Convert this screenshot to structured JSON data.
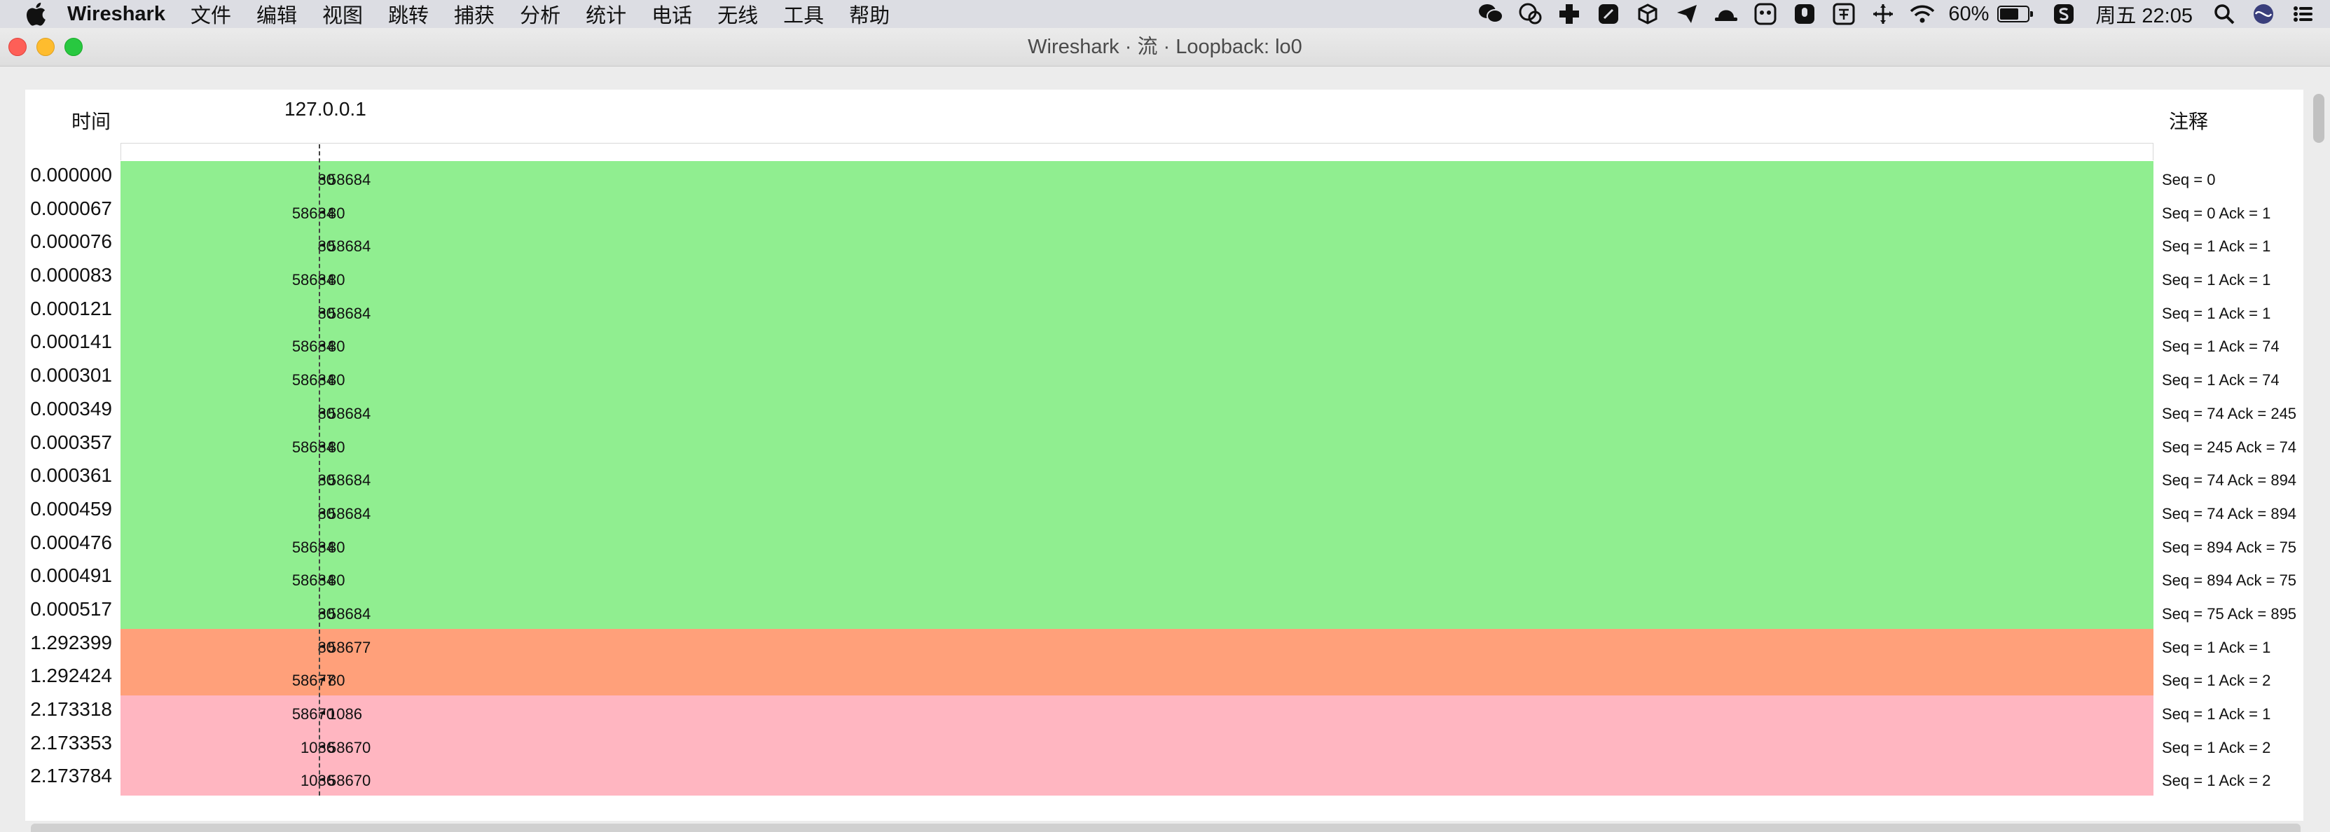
{
  "menubar": {
    "app": "Wireshark",
    "items": [
      "文件",
      "编辑",
      "视图",
      "跳转",
      "捕获",
      "分析",
      "统计",
      "电话",
      "无线",
      "工具",
      "帮助"
    ],
    "battery": "60%",
    "clock": "周五 22:05",
    "tray_icons": [
      "wechat-icon",
      "qq-icon",
      "plus-app-icon",
      "feather-icon",
      "cube-icon",
      "paper-plane-icon",
      "hat-icon",
      "face-icon",
      "microphone-icon",
      "input-method-icon",
      "move-icon",
      "wifi-icon",
      "battery-icon",
      "s-app-icon",
      "search-icon",
      "siri-icon",
      "control-center-icon"
    ]
  },
  "window": {
    "title": "Wireshark · 流 · Loopback: lo0"
  },
  "flow": {
    "header_time": "时间",
    "header_node": "127.0.0.1",
    "header_comment": "注释",
    "colors": {
      "green": "#90ee90",
      "orange": "#ffa07a",
      "pink": "#ffb6c1"
    },
    "rows": [
      {
        "time": "0.000000",
        "src": "80",
        "dst": "58684",
        "note": "Seq = 0",
        "color": "#90ee90"
      },
      {
        "time": "0.000067",
        "src": "58684",
        "dst": "80",
        "note": "Seq = 0 Ack = 1",
        "color": "#90ee90"
      },
      {
        "time": "0.000076",
        "src": "80",
        "dst": "58684",
        "note": "Seq = 1 Ack = 1",
        "color": "#90ee90"
      },
      {
        "time": "0.000083",
        "src": "58684",
        "dst": "80",
        "note": "Seq = 1 Ack = 1",
        "color": "#90ee90"
      },
      {
        "time": "0.000121",
        "src": "80",
        "dst": "58684",
        "note": "Seq = 1 Ack = 1",
        "color": "#90ee90"
      },
      {
        "time": "0.000141",
        "src": "58684",
        "dst": "80",
        "note": "Seq = 1 Ack = 74",
        "color": "#90ee90"
      },
      {
        "time": "0.000301",
        "src": "58684",
        "dst": "80",
        "note": "Seq = 1 Ack = 74",
        "color": "#90ee90"
      },
      {
        "time": "0.000349",
        "src": "80",
        "dst": "58684",
        "note": "Seq = 74 Ack = 245",
        "color": "#90ee90"
      },
      {
        "time": "0.000357",
        "src": "58684",
        "dst": "80",
        "note": "Seq = 245 Ack = 74",
        "color": "#90ee90"
      },
      {
        "time": "0.000361",
        "src": "80",
        "dst": "58684",
        "note": "Seq = 74 Ack = 894",
        "color": "#90ee90"
      },
      {
        "time": "0.000459",
        "src": "80",
        "dst": "58684",
        "note": "Seq = 74 Ack = 894",
        "color": "#90ee90"
      },
      {
        "time": "0.000476",
        "src": "58684",
        "dst": "80",
        "note": "Seq = 894 Ack = 75",
        "color": "#90ee90"
      },
      {
        "time": "0.000491",
        "src": "58684",
        "dst": "80",
        "note": "Seq = 894 Ack = 75",
        "color": "#90ee90"
      },
      {
        "time": "0.000517",
        "src": "80",
        "dst": "58684",
        "note": "Seq = 75 Ack = 895",
        "color": "#90ee90"
      },
      {
        "time": "1.292399",
        "src": "80",
        "dst": "58677",
        "note": "Seq = 1 Ack = 1",
        "color": "#ffa07a"
      },
      {
        "time": "1.292424",
        "src": "58677",
        "dst": "80",
        "note": "Seq = 1 Ack = 2",
        "color": "#ffa07a"
      },
      {
        "time": "2.173318",
        "src": "58670",
        "dst": "1086",
        "note": "Seq = 1 Ack = 1",
        "color": "#ffb6c1"
      },
      {
        "time": "2.173353",
        "src": "1086",
        "dst": "58670",
        "note": "Seq = 1 Ack = 2",
        "color": "#ffb6c1"
      },
      {
        "time": "2.173784",
        "src": "1086",
        "dst": "58670",
        "note": "Seq = 1 Ack = 2",
        "color": "#ffb6c1"
      }
    ]
  }
}
